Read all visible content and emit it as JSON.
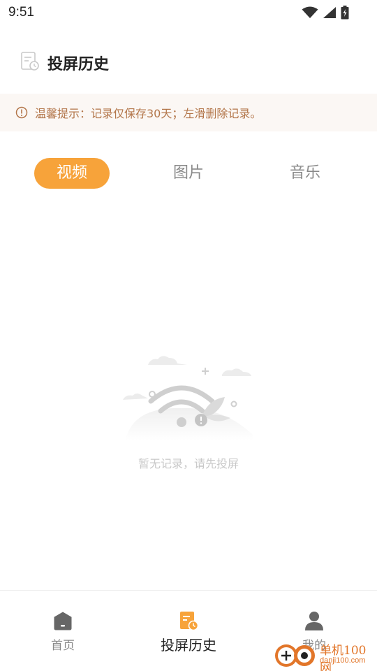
{
  "status_bar": {
    "time": "9:51",
    "icons": [
      "wifi-icon",
      "signal-icon",
      "battery-charging-icon"
    ]
  },
  "header": {
    "title": "投屏历史",
    "icon": "history-document-icon"
  },
  "tip": {
    "icon": "info-icon",
    "text": "温馨提示：记录仅保存30天；左滑删除记录。"
  },
  "tabs": [
    {
      "label": "视频",
      "active": true
    },
    {
      "label": "图片",
      "active": false
    },
    {
      "label": "音乐",
      "active": false
    }
  ],
  "empty_state": {
    "illustration": "no-connection-illustration",
    "text": "暂无记录，请先投屏"
  },
  "bottom_nav": {
    "items": [
      {
        "label": "首页",
        "icon": "home-icon",
        "active": false
      },
      {
        "label": "投屏历史",
        "icon": "history-document-icon",
        "active": true
      },
      {
        "label": "我的",
        "icon": "user-icon",
        "active": false
      }
    ]
  },
  "watermark": {
    "name": "单机100网",
    "url": "danji100.com"
  },
  "colors": {
    "accent": "#f7a33a",
    "tip_background": "#fbf7f4",
    "tip_text": "#b3764a",
    "inactive_text": "#8a8a8a"
  }
}
